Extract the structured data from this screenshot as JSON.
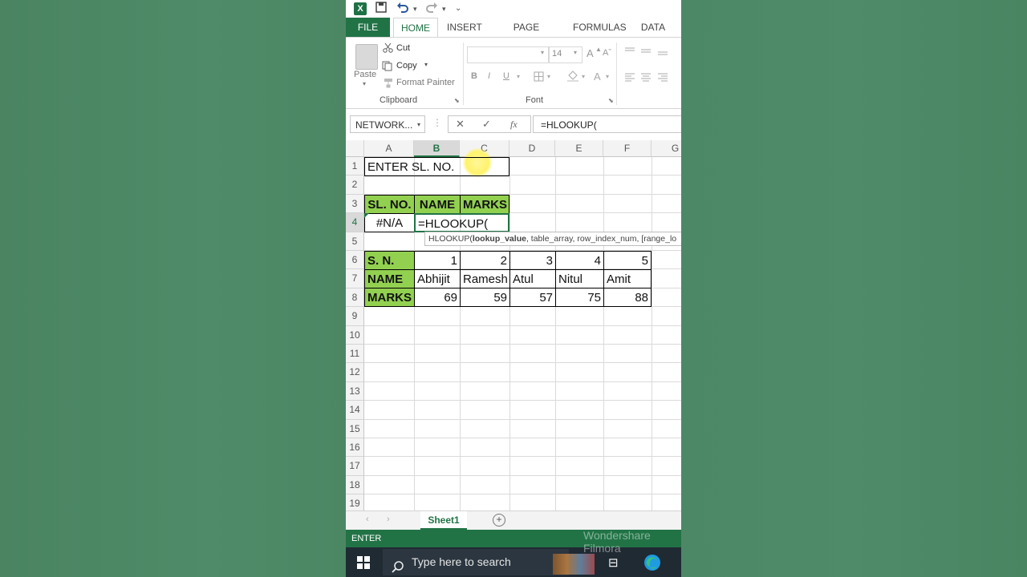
{
  "window": {
    "app_icon": "X"
  },
  "ribbon": {
    "tabs": [
      "FILE",
      "HOME",
      "INSERT",
      "PAGE LAYOUT",
      "FORMULAS",
      "DATA"
    ],
    "clipboard": {
      "paste": "Paste",
      "cut": "Cut",
      "copy": "Copy",
      "format_painter": "Format Painter",
      "group_label": "Clipboard"
    },
    "font": {
      "size": "14",
      "bold": "B",
      "italic": "I",
      "underline": "U",
      "grow": "A",
      "font_color": "A",
      "group_label": "Font"
    }
  },
  "formula_bar": {
    "name_box": "NETWORK...",
    "cancel": "✕",
    "enter": "✓",
    "fx": "fx",
    "content": "=HLOOKUP("
  },
  "grid": {
    "columns": [
      "A",
      "B",
      "C",
      "D",
      "E",
      "F",
      "G"
    ],
    "selected_column": "B",
    "rows": [
      "1",
      "2",
      "3",
      "4",
      "5",
      "6",
      "7",
      "8",
      "9",
      "10",
      "11",
      "12",
      "13",
      "14",
      "15",
      "16",
      "17",
      "18",
      "19"
    ],
    "selected_row": "4",
    "cells": {
      "A1": "ENTER SL. NO.",
      "A3": "SL. NO.",
      "B3": "NAME",
      "C3": "MARKS",
      "A4": "#N/A",
      "B4": "=HLOOKUP(",
      "A6": "S. N.",
      "B6": "1",
      "C6": "2",
      "D6": "3",
      "E6": "4",
      "F6": "5",
      "A7": "NAME",
      "B7": "Abhijit",
      "C7": "Ramesh",
      "D7": "Atul",
      "E7": "Nitul",
      "F7": "Amit",
      "A8": "MARKS",
      "B8": "69",
      "C8": "59",
      "D8": "57",
      "E8": "75",
      "F8": "88"
    },
    "tooltip": {
      "fn": "HLOOKUP(",
      "current_arg": "lookup_value",
      "rest": ", table_array, row_index_num, [range_lo"
    },
    "accent_green": "#92d050"
  },
  "sheets": {
    "active": "Sheet1",
    "add_icon": "+"
  },
  "status": {
    "mode": "ENTER"
  },
  "taskbar": {
    "search_placeholder": "Type here to search"
  },
  "watermark": {
    "line1": "Wondershare",
    "line2": "Filmora"
  }
}
